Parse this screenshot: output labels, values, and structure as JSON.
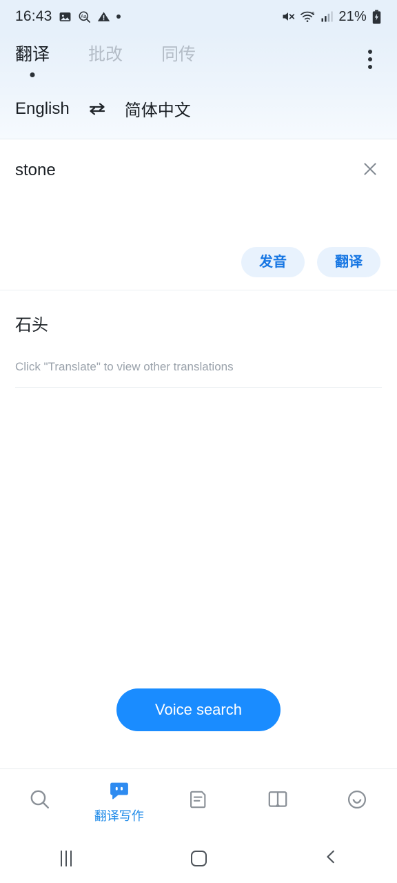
{
  "status_bar": {
    "time": "16:43",
    "battery_percent": "21%",
    "left_icons": [
      "image-icon",
      "text-search-icon",
      "warning-icon",
      "dot-icon"
    ],
    "right_icons": [
      "mute-icon",
      "wifi-6-icon",
      "signal-bars-icon",
      "battery-charging-icon"
    ]
  },
  "header": {
    "tabs": [
      {
        "label": "翻译",
        "active": true
      },
      {
        "label": "批改",
        "active": false
      },
      {
        "label": "同传",
        "active": false
      }
    ],
    "overflow_label": "more-options",
    "source_language": "English",
    "target_language": "简体中文",
    "swap_icon": "swap-horizontal-icon"
  },
  "input": {
    "value": "stone",
    "placeholder": "stone",
    "clear_icon": "close-icon",
    "pronounce_label": "发音",
    "translate_label": "翻译"
  },
  "result": {
    "translation": "石头",
    "hint": "Click \"Translate\" to view other translations"
  },
  "voice": {
    "label": "Voice search"
  },
  "bottom_nav": {
    "items": [
      {
        "label": "",
        "icon": "search-icon",
        "active": false
      },
      {
        "label": "翻译写作",
        "icon": "translate-writing-icon",
        "active": true
      },
      {
        "label": "",
        "icon": "document-icon",
        "active": false
      },
      {
        "label": "",
        "icon": "book-icon",
        "active": false
      },
      {
        "label": "",
        "icon": "smiley-icon",
        "active": false
      }
    ]
  },
  "android_nav": {
    "recents_label": "recents",
    "home_label": "home",
    "back_label": "back"
  },
  "colors": {
    "accent_blue": "#1a8cff",
    "pill_blue_text": "#1676e3",
    "pill_blue_bg": "#e8f2fd",
    "header_gradient_top": "#e6f0fa",
    "nav_active": "#1e8ae8"
  }
}
